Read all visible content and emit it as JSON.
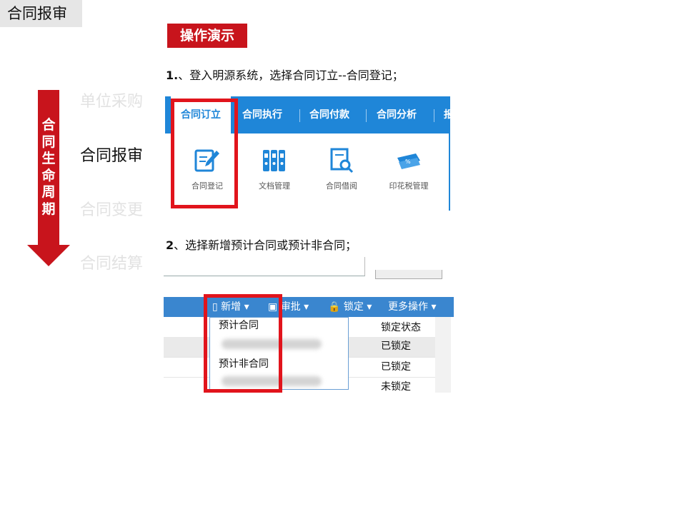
{
  "header": {
    "title": "合同报审"
  },
  "lifecycle": {
    "label": [
      "合",
      "同",
      "生",
      "命",
      "周",
      "期"
    ],
    "stages": [
      "单位采购",
      "合同报审",
      "合同变更",
      "合同结算"
    ],
    "active_index": 1
  },
  "demo": {
    "tag": "操作演示"
  },
  "steps": [
    {
      "num": "1.",
      "text": "、登入明源系统，选择合同订立--合同登记；"
    },
    {
      "num": "2",
      "text": "、选择新增预计合同或预计非合同；"
    }
  ],
  "screenshot1": {
    "tabs": [
      "合同订立",
      "合同执行",
      "合同付款",
      "合同分析",
      "报"
    ],
    "tools": [
      {
        "label": "合同登记",
        "icon": "pencil-edit-icon"
      },
      {
        "label": "文档管理",
        "icon": "binders-icon"
      },
      {
        "label": "合同借阅",
        "icon": "document-search-icon"
      },
      {
        "label": "印花税管理",
        "icon": "tax-ticket-icon"
      }
    ],
    "highlight_color": "#e1141c"
  },
  "screenshot2": {
    "toolbar": {
      "new_label": "新增",
      "approve_label": "审批",
      "lock_label": "锁定",
      "more_label": "更多操作"
    },
    "dropdown": [
      "预计合同",
      "预计非合同"
    ],
    "column_header": "锁定状态",
    "rows": [
      "已锁定",
      "已锁定",
      "未锁定"
    ]
  }
}
